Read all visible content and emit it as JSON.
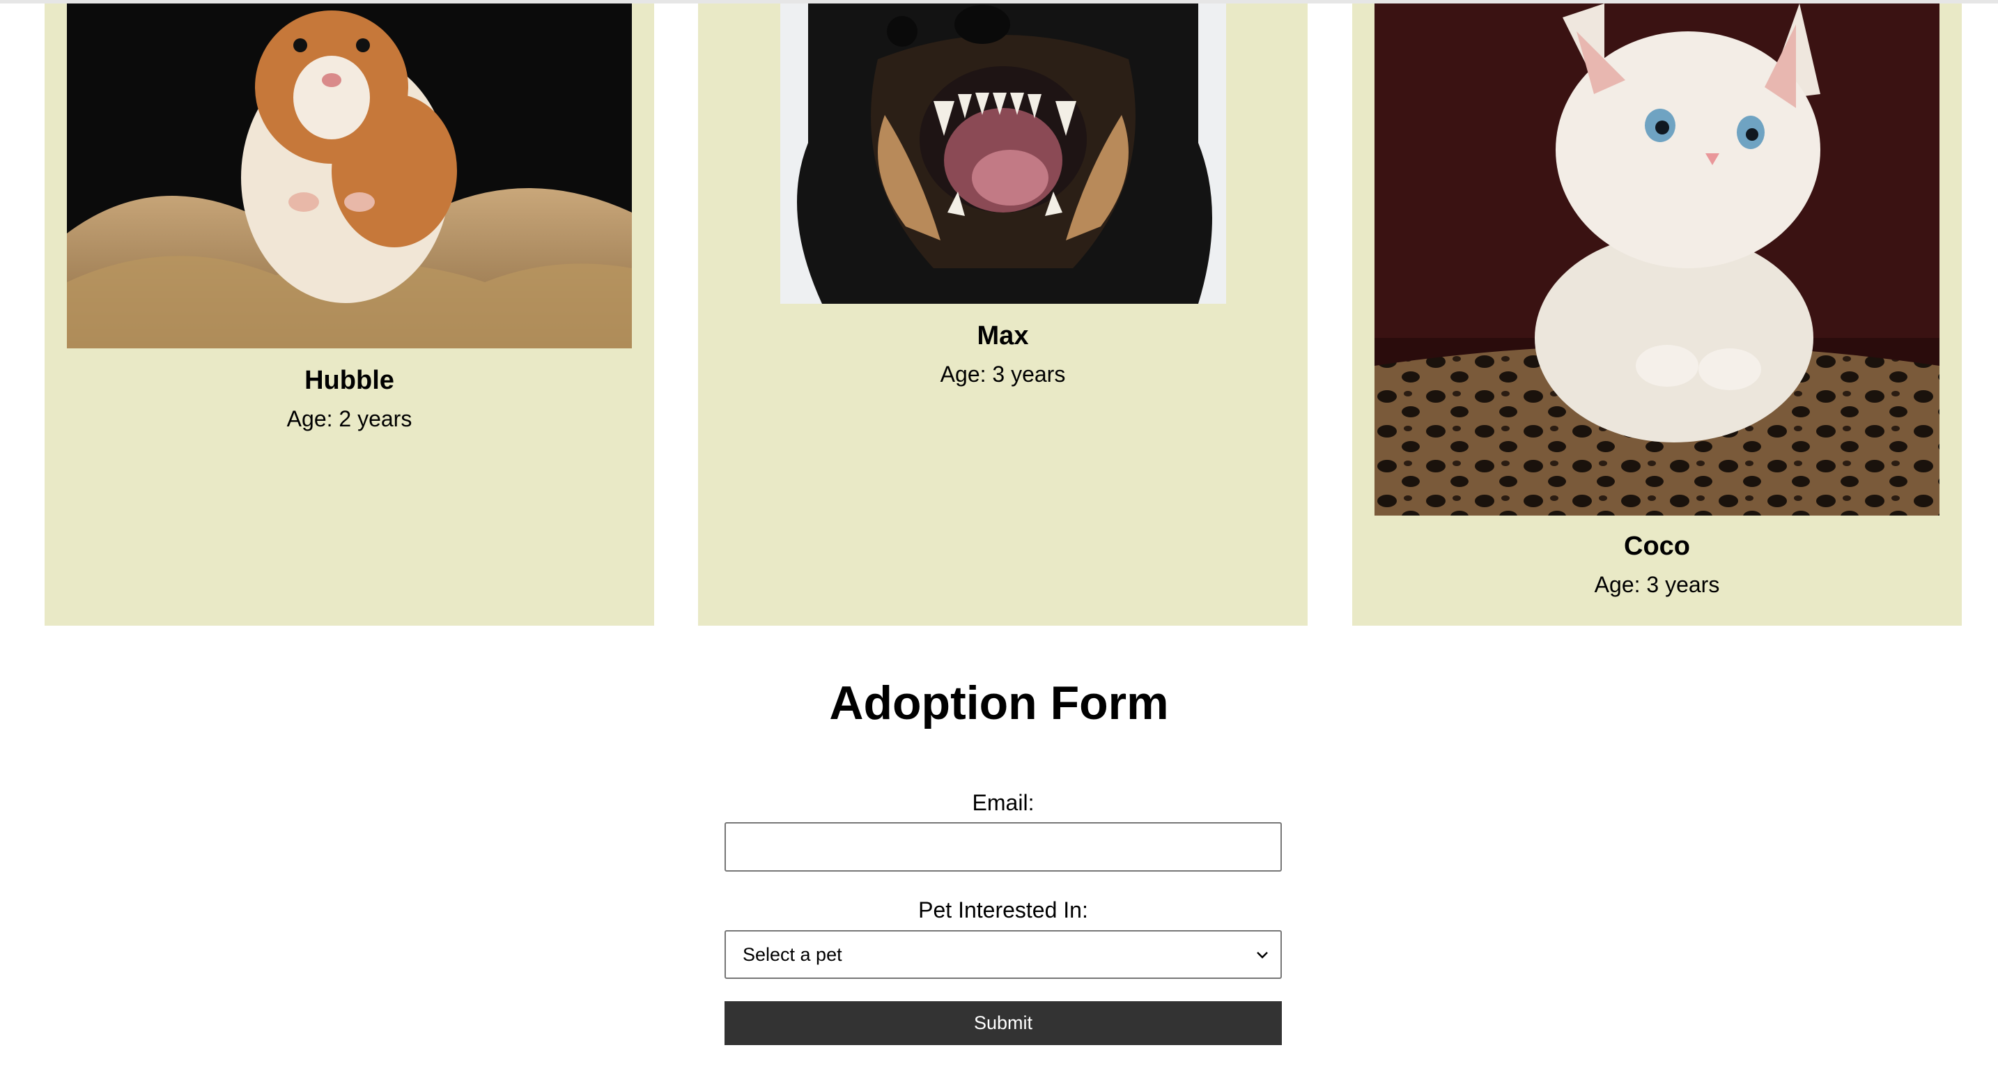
{
  "pets": [
    {
      "name": "Hubble",
      "age": "Age: 2 years",
      "photo_icon": "hamster-photo"
    },
    {
      "name": "Max",
      "age": "Age: 3 years",
      "photo_icon": "dog-photo"
    },
    {
      "name": "Coco",
      "age": "Age: 3 years",
      "photo_icon": "kitten-photo"
    }
  ],
  "form": {
    "title": "Adoption Form",
    "email_label": "Email:",
    "email_value": "",
    "pet_label": "Pet Interested In:",
    "pet_selected": "Select a pet",
    "submit_label": "Submit"
  },
  "colors": {
    "card_background": "#e9e9c6",
    "button_background": "#333333",
    "button_text": "#ffffff"
  }
}
